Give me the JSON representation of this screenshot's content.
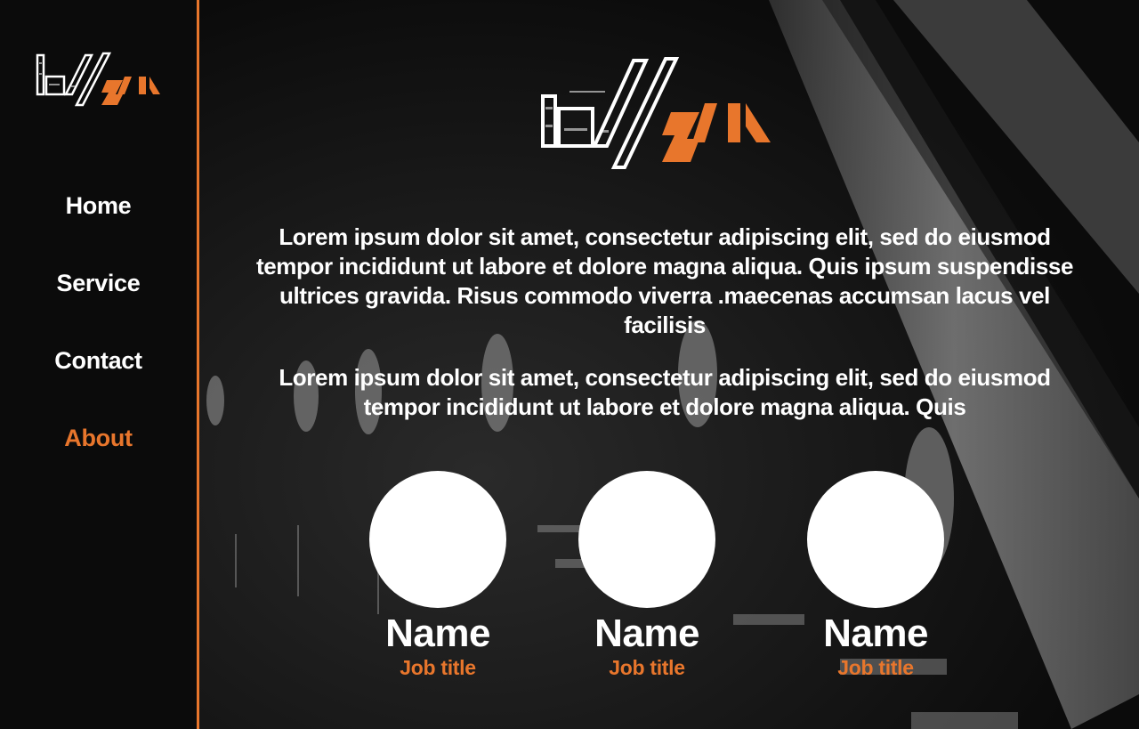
{
  "brand": {
    "logo_text": "wolfagile",
    "accent_color": "#e8762c"
  },
  "sidebar": {
    "items": [
      {
        "label": "Home",
        "active": false
      },
      {
        "label": "Service",
        "active": false
      },
      {
        "label": "Contact",
        "active": false
      },
      {
        "label": "About",
        "active": true
      }
    ]
  },
  "main": {
    "paragraphs": [
      "Lorem ipsum dolor sit amet, consectetur adipiscing elit, sed do eiusmod tempor incididunt ut labore et dolore magna aliqua. Quis ipsum suspendisse ultrices gravida. Risus commodo viverra .maecenas accumsan lacus vel facilisis",
      "Lorem ipsum dolor sit amet, consectetur adipiscing elit, sed do eiusmod tempor incididunt ut labore et dolore magna aliqua. Quis"
    ],
    "team": [
      {
        "name": "Name",
        "job_title": "Job title"
      },
      {
        "name": "Name",
        "job_title": "Job title"
      },
      {
        "name": "Name",
        "job_title": "Job title"
      }
    ]
  }
}
